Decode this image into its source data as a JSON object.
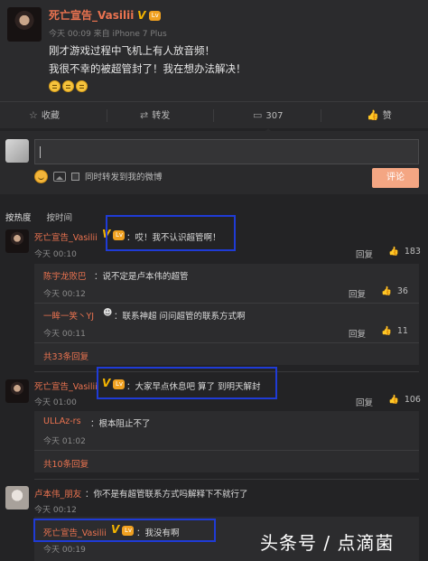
{
  "post": {
    "author": "死亡宣告_Vasilii",
    "meta": "今天 00:09 来自 iPhone 7 Plus",
    "lines": [
      "刚才游戏过程中飞机上有人放音频！",
      "我很不幸的被超管封了！我在想办法解决！"
    ],
    "badge": "V",
    "level_badge": "Lv"
  },
  "actions": {
    "favorite": "收藏",
    "repost": "转发",
    "comment": "307",
    "like": "赞"
  },
  "compose": {
    "repost_also": "同时转发到我的微博",
    "submit": "评论"
  },
  "sort": {
    "hot": "按热度",
    "time": "按时间"
  },
  "comments": [
    {
      "name": "死亡宣告_Vasilii",
      "text": "：哎！我不认识超管啊！",
      "time": "今天 00:10",
      "reply": "回复",
      "likes": "183",
      "replies": [
        {
          "name": "陈宇龙败巴",
          "text": "：说不定是卢本伟的超管",
          "time": "今天 00:12",
          "reply": "回复",
          "likes": "36"
        },
        {
          "name": "一眸一笑丶YJ",
          "text": "：联系神超 问问超管的联系方式啊",
          "time": "今天 00:11",
          "reply": "回复",
          "likes": "11"
        }
      ],
      "more": "共33条回复"
    },
    {
      "name": "死亡宣告_Vasilii",
      "text": "：大家早点休息吧 算了 到明天解封",
      "time": "今天 01:00",
      "reply": "回复",
      "likes": "106",
      "replies": [
        {
          "name": "ULLAz-rs",
          "text": "：根本阻止不了",
          "time": "今天 01:02",
          "reply": "回复",
          "likes": ""
        }
      ],
      "more": "共10条回复"
    },
    {
      "name": "卢本伟_朋友",
      "text": "：你不是有超管联系方式吗解释下不就行了",
      "time": "今天 00:12",
      "reply": "回复",
      "likes": "",
      "replies": [
        {
          "name": "死亡宣告_Vasilii",
          "text": "：我没有啊",
          "time": "今天 00:19",
          "reply": "",
          "likes": ""
        }
      ],
      "more": ""
    }
  ],
  "watermark": "头条号 / 点滴菌"
}
